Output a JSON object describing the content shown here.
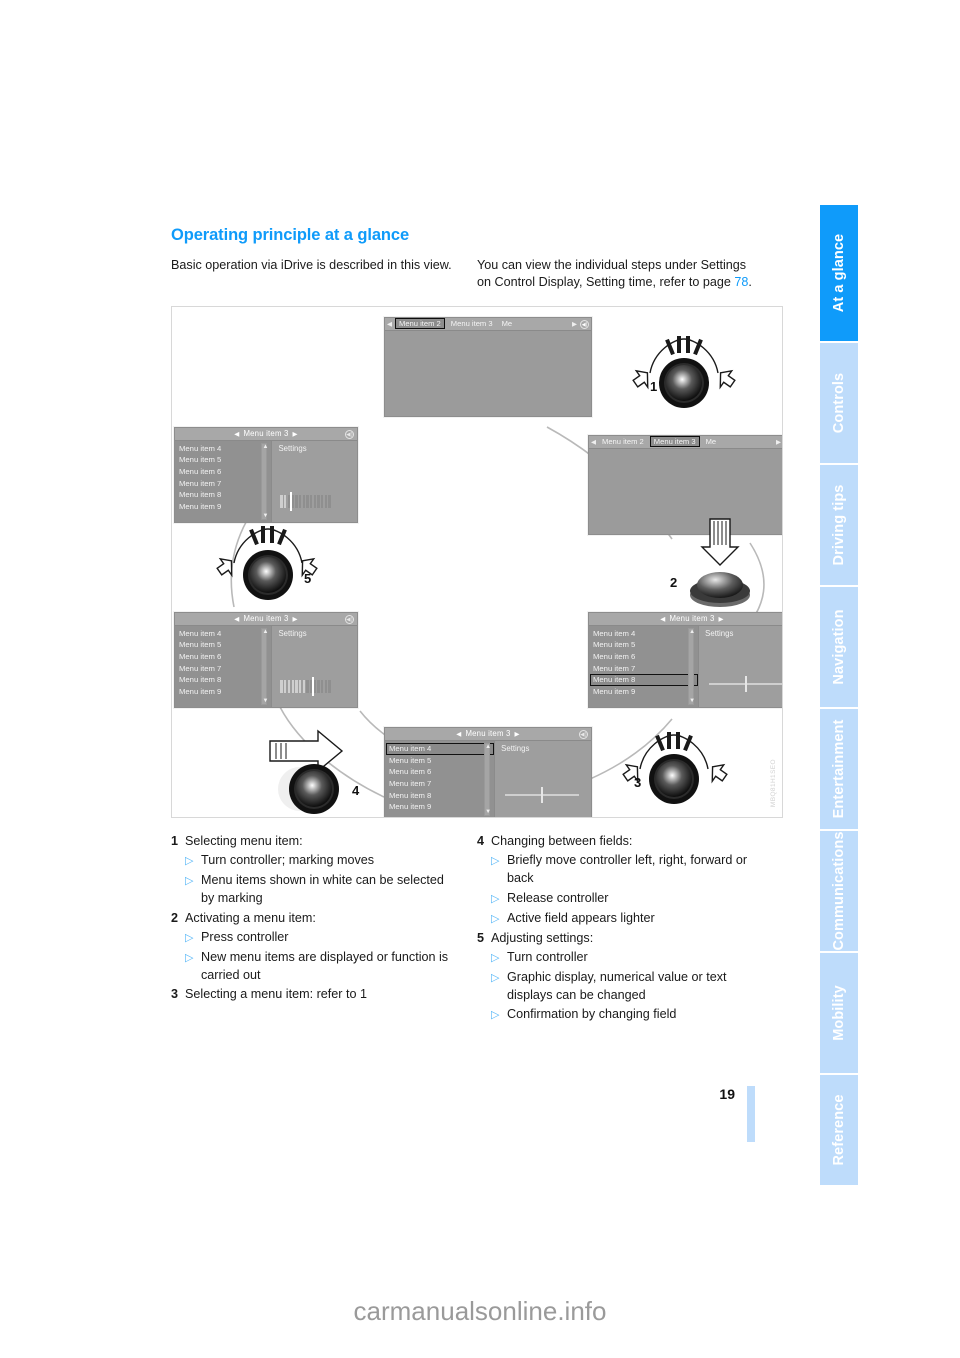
{
  "document": {
    "title": "Operating principle at a glance",
    "page_number": "19",
    "watermark": "carmanualsonline.info",
    "figure_code": "MBQ81H1SEO"
  },
  "intro": {
    "left": "Basic operation via iDrive is described in this view.",
    "right_before": "You can view the individual steps under Settings on Control Display, Setting time, refer to page ",
    "page_ref": "78",
    "right_after": "."
  },
  "sidebar": {
    "tabs": [
      {
        "label": "At a glance",
        "active": true
      },
      {
        "label": "Controls",
        "active": false
      },
      {
        "label": "Driving tips",
        "active": false
      },
      {
        "label": "Navigation",
        "active": false
      },
      {
        "label": "Entertainment",
        "active": false
      },
      {
        "label": "Communications",
        "active": false
      },
      {
        "label": "Mobility",
        "active": false
      },
      {
        "label": "Reference",
        "active": false
      }
    ]
  },
  "figure": {
    "screens": {
      "top_center": {
        "type": "tabs",
        "tabs": [
          "Menu item 2",
          "Menu item 3",
          "Me"
        ],
        "selected_tab": "Menu item 2"
      },
      "mid_right": {
        "type": "tabs",
        "tabs": [
          "Menu item 2",
          "Menu item 3",
          "Me"
        ],
        "selected_tab": "Menu item 3"
      },
      "mid_left": {
        "type": "list",
        "header": "Menu item 3",
        "items": [
          "Menu item 4",
          "Menu item 5",
          "Menu item 6",
          "Menu item 7",
          "Menu item 8",
          "Menu item 9"
        ],
        "selected": "",
        "right_pane_label": "Settings",
        "widget": "bargraph-low"
      },
      "lower_left": {
        "type": "list",
        "header": "Menu item 3",
        "items": [
          "Menu item 4",
          "Menu item 5",
          "Menu item 6",
          "Menu item 7",
          "Menu item 8",
          "Menu item 9"
        ],
        "selected": "",
        "right_pane_label": "Settings",
        "widget": "bargraph-high"
      },
      "lower_right": {
        "type": "list",
        "header": "Menu item 3",
        "items": [
          "Menu item 4",
          "Menu item 5",
          "Menu item 6",
          "Menu item 7",
          "Menu item 8",
          "Menu item 9"
        ],
        "selected": "Menu item 8",
        "right_pane_label": "Settings",
        "widget": "linear"
      },
      "bottom_center": {
        "type": "list",
        "header": "Menu item 3",
        "items": [
          "Menu item 4",
          "Menu item 5",
          "Menu item 6",
          "Menu item 7",
          "Menu item 8",
          "Menu item 9"
        ],
        "selected": "Menu item 4",
        "right_pane_label": "Settings",
        "widget": "linear"
      }
    },
    "controllers": [
      {
        "number": "1",
        "action": "rotate"
      },
      {
        "number": "2",
        "action": "press"
      },
      {
        "number": "3",
        "action": "rotate"
      },
      {
        "number": "4",
        "action": "move-sideways"
      },
      {
        "number": "5",
        "action": "rotate"
      }
    ]
  },
  "steps": {
    "left": [
      {
        "num": "1",
        "title": "Selecting menu item:",
        "bullets": [
          "Turn controller; marking moves",
          "Menu items shown in white can be selected by marking"
        ]
      },
      {
        "num": "2",
        "title": "Activating a menu item:",
        "bullets": [
          "Press controller",
          "New menu items are displayed or function is carried out"
        ]
      },
      {
        "num": "3",
        "title": "Selecting a menu item: refer to 1",
        "bullets": []
      }
    ],
    "right": [
      {
        "num": "4",
        "title": "Changing between fields:",
        "bullets": [
          "Briefly move controller left, right, forward or back",
          "Release controller",
          "Active field appears lighter"
        ]
      },
      {
        "num": "5",
        "title": "Adjusting settings:",
        "bullets": [
          "Turn controller",
          "Graphic display, numerical value or text displays can be changed",
          "Confirmation by changing field"
        ]
      }
    ]
  }
}
